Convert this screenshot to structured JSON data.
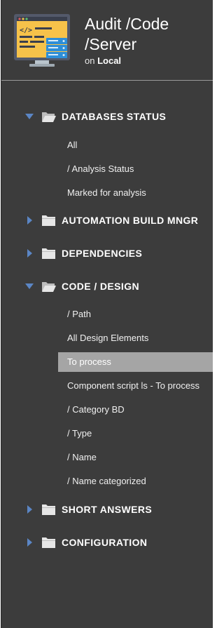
{
  "header": {
    "title": "Audit /Code /Server",
    "subtitle_prefix": "on",
    "subtitle_server": "Local",
    "icon": "code-monitor-icon"
  },
  "tree": {
    "sections": [
      {
        "label": "DATABASES STATUS",
        "expanded": true,
        "items": [
          "All",
          "/ Analysis Status",
          "Marked for analysis"
        ]
      },
      {
        "label": "AUTOMATION BUILD MNGR",
        "expanded": false,
        "items": []
      },
      {
        "label": "DEPENDENCIES",
        "expanded": false,
        "items": []
      },
      {
        "label": "CODE / DESIGN",
        "expanded": true,
        "items": [
          "/ Path",
          "All Design Elements",
          "To process",
          "Component script ls - To process",
          "/ Category BD",
          "/ Type",
          "/ Name",
          "/ Name categorized"
        ]
      },
      {
        "label": "SHORT ANSWERS",
        "expanded": false,
        "items": []
      },
      {
        "label": "CONFIGURATION",
        "expanded": false,
        "items": []
      }
    ],
    "selected_item": "To process"
  },
  "colors": {
    "background": "#3c3c3c",
    "selected": "#a5a5a5",
    "caret": "#5b86c5",
    "folder": "#e6e6e6"
  }
}
